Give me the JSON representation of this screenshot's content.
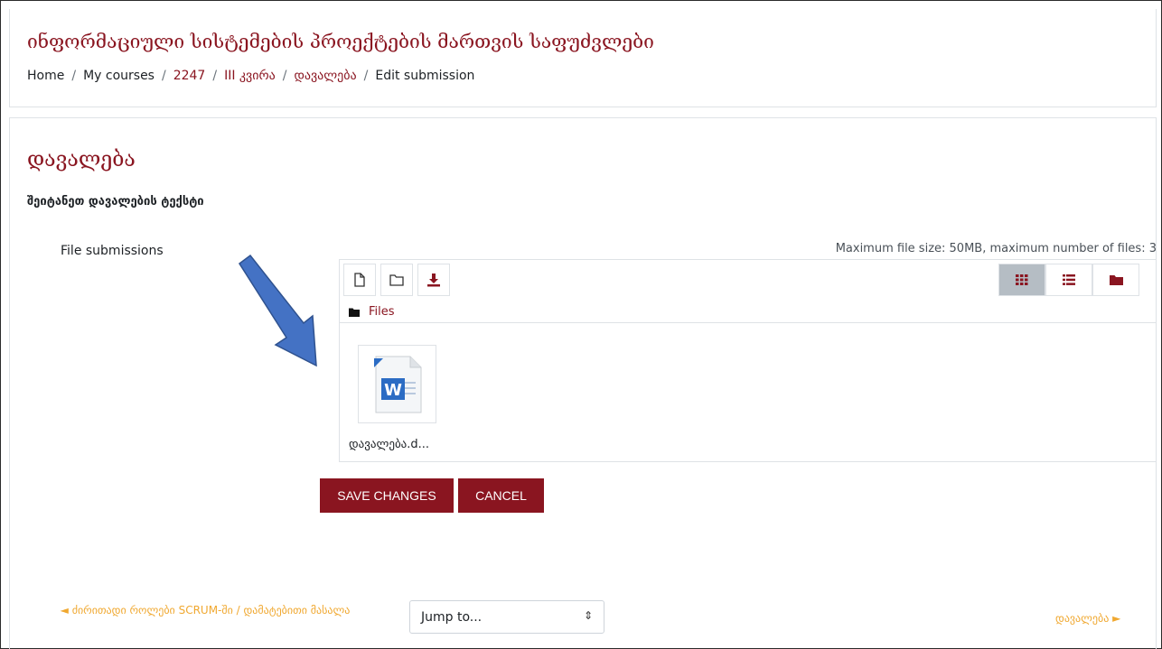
{
  "course": {
    "title": "ინფორმაციული სისტემების პროექტების მართვის საფუძვლები"
  },
  "breadcrumb": [
    {
      "label": "Home",
      "link": false
    },
    {
      "label": "My courses",
      "link": false
    },
    {
      "label": "2247",
      "link": true
    },
    {
      "label": "III კვირა",
      "link": true
    },
    {
      "label": "დავალება",
      "link": true
    },
    {
      "label": "Edit submission",
      "link": false
    }
  ],
  "page": {
    "heading": "დავალება",
    "subheading": "შეიტანეთ დავალების ტექსტი"
  },
  "form": {
    "field_label": "File submissions",
    "limits": "Maximum file size: 50MB, maximum number of files: 3",
    "folder_crumb": "Files",
    "file": {
      "name": "დავალება.d...",
      "icon": "word-document-icon"
    },
    "save_label": "SAVE CHANGES",
    "cancel_label": "CANCEL"
  },
  "toolbar": {
    "icons": [
      "add-file-icon",
      "create-folder-icon",
      "download-icon"
    ],
    "views": [
      "grid-view-icon",
      "list-view-icon",
      "tree-view-icon"
    ]
  },
  "nav": {
    "prev_label": "◄ ძირითადი როლები SCRUM-ში / დამატებითი მასალა",
    "jump_label": "Jump to...",
    "next_label": "დავალება ►"
  },
  "colors": {
    "brand": "#8a1520",
    "nav_link": "#f0a830",
    "arrow": "#4472c4"
  }
}
